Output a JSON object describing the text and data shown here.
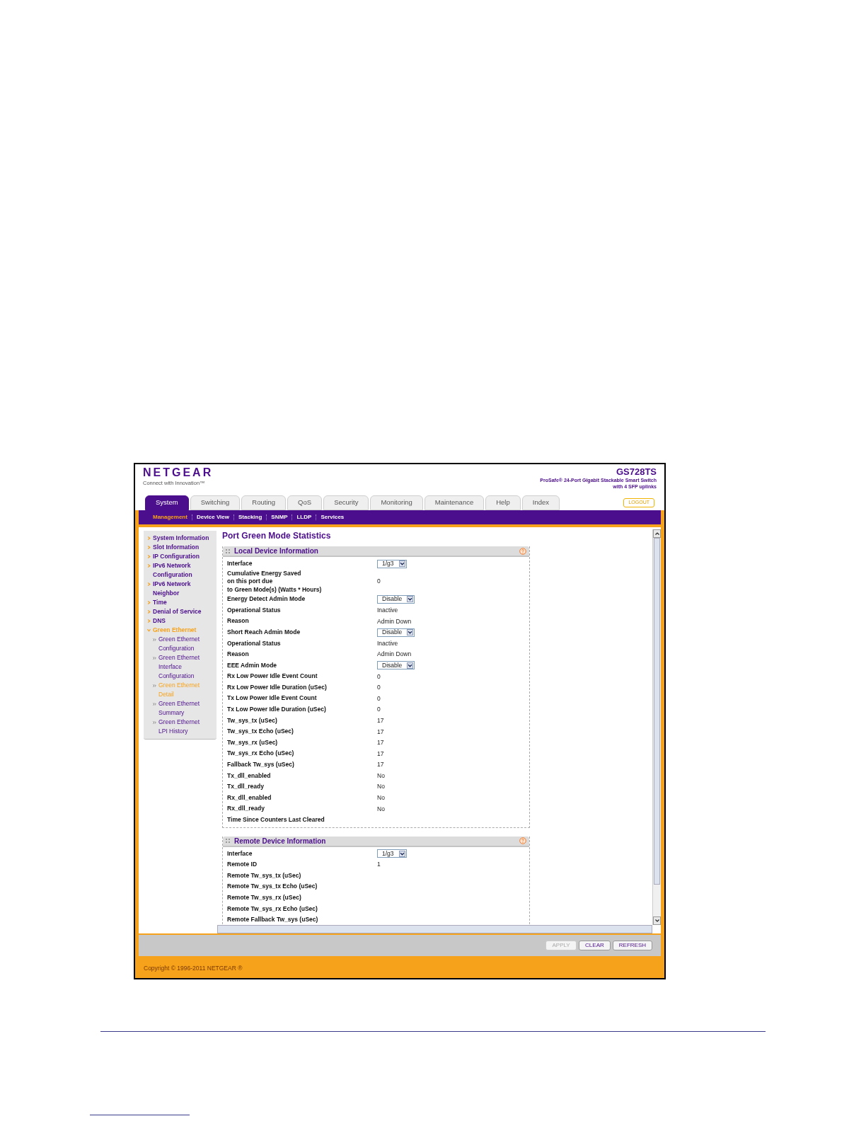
{
  "header": {
    "logo": "NETGEAR",
    "tagline": "Connect with Innovation™",
    "model": "GS728TS",
    "description": [
      "ProSafe® 24-Port Gigabit Stackable Smart Switch",
      "with 4 SFP uplinks"
    ]
  },
  "tabs": [
    {
      "label": "System",
      "selected": true
    },
    {
      "label": "Switching",
      "selected": false
    },
    {
      "label": "Routing",
      "selected": false
    },
    {
      "label": "QoS",
      "selected": false
    },
    {
      "label": "Security",
      "selected": false
    },
    {
      "label": "Monitoring",
      "selected": false
    },
    {
      "label": "Maintenance",
      "selected": false
    },
    {
      "label": "Help",
      "selected": false
    },
    {
      "label": "Index",
      "selected": false
    }
  ],
  "logout": "LOGOUT",
  "subnav": [
    {
      "label": "Management",
      "selected": true
    },
    {
      "label": "Device View",
      "selected": false
    },
    {
      "label": "Stacking",
      "selected": false
    },
    {
      "label": "SNMP",
      "selected": false
    },
    {
      "label": "LLDP",
      "selected": false
    },
    {
      "label": "Services",
      "selected": false
    }
  ],
  "sidebar": {
    "items": [
      {
        "label": "System Information",
        "expanded": false,
        "selected": false
      },
      {
        "label": "Slot Information",
        "expanded": false,
        "selected": false
      },
      {
        "label": "IP Configuration",
        "expanded": false,
        "selected": false
      },
      {
        "label": "IPv6 Network Configuration",
        "expanded": false,
        "selected": false
      },
      {
        "label": "IPv6 Network Neighbor",
        "expanded": false,
        "selected": false
      },
      {
        "label": "Time",
        "expanded": false,
        "selected": false
      },
      {
        "label": "Denial of Service",
        "expanded": false,
        "selected": false
      },
      {
        "label": "DNS",
        "expanded": false,
        "selected": false
      },
      {
        "label": "Green Ethernet",
        "expanded": true,
        "selected": true,
        "children": [
          {
            "label": "Green Ethernet Configuration",
            "selected": false
          },
          {
            "label": "Green Ethernet Interface Configuration",
            "selected": false
          },
          {
            "label": "Green Ethernet Detail",
            "selected": true
          },
          {
            "label": "Green Ethernet Summary",
            "selected": false
          },
          {
            "label": "Green Ethernet LPI History",
            "selected": false
          }
        ]
      }
    ]
  },
  "page_title": "Port Green Mode Statistics",
  "sections": [
    {
      "title": "Local Device Information",
      "rows": [
        {
          "label": "Interface",
          "kind": "select",
          "value": "1/g3"
        },
        {
          "label": "Cumulative Energy Saved\non this port due\nto Green Mode(s) (Watts * Hours)",
          "kind": "text",
          "value": "0"
        },
        {
          "label": "Energy Detect Admin Mode",
          "kind": "select",
          "value": "Disable"
        },
        {
          "label": "Operational Status",
          "kind": "text",
          "value": "Inactive"
        },
        {
          "label": "Reason",
          "kind": "text",
          "value": "Admin Down"
        },
        {
          "label": "Short Reach Admin Mode",
          "kind": "select",
          "value": "Disable"
        },
        {
          "label": "Operational Status",
          "kind": "text",
          "value": "Inactive"
        },
        {
          "label": "Reason",
          "kind": "text",
          "value": "Admin Down"
        },
        {
          "label": "EEE Admin Mode",
          "kind": "select",
          "value": "Disable"
        },
        {
          "label": "Rx Low Power Idle Event Count",
          "kind": "text",
          "value": "0"
        },
        {
          "label": "Rx Low Power Idle Duration (uSec)",
          "kind": "text",
          "value": "0"
        },
        {
          "label": "Tx Low Power Idle Event Count",
          "kind": "text",
          "value": "0"
        },
        {
          "label": "Tx Low Power Idle Duration (uSec)",
          "kind": "text",
          "value": "0"
        },
        {
          "label": "Tw_sys_tx (uSec)",
          "kind": "text",
          "value": "17"
        },
        {
          "label": "Tw_sys_tx Echo (uSec)",
          "kind": "text",
          "value": "17"
        },
        {
          "label": "Tw_sys_rx (uSec)",
          "kind": "text",
          "value": "17"
        },
        {
          "label": "Tw_sys_rx Echo (uSec)",
          "kind": "text",
          "value": "17"
        },
        {
          "label": "Fallback Tw_sys (uSec)",
          "kind": "text",
          "value": "17"
        },
        {
          "label": "Tx_dll_enabled",
          "kind": "text",
          "value": "No"
        },
        {
          "label": "Tx_dll_ready",
          "kind": "text",
          "value": "No"
        },
        {
          "label": "Rx_dll_enabled",
          "kind": "text",
          "value": "No"
        },
        {
          "label": "Rx_dll_ready",
          "kind": "text",
          "value": "No"
        },
        {
          "label": "Time Since Counters Last Cleared",
          "kind": "text"
        }
      ]
    },
    {
      "title": "Remote Device Information",
      "rows": [
        {
          "label": "Interface",
          "kind": "select",
          "value": "1/g3"
        },
        {
          "label": "Remote ID",
          "kind": "text",
          "value": "1"
        },
        {
          "label": "Remote Tw_sys_tx (uSec)",
          "kind": "text"
        },
        {
          "label": "Remote Tw_sys_tx Echo (uSec)",
          "kind": "text"
        },
        {
          "label": "Remote Tw_sys_rx (uSec)",
          "kind": "text"
        },
        {
          "label": "Remote Tw_sys_rx Echo (uSec)",
          "kind": "text"
        },
        {
          "label": "Remote Fallback Tw_sys (uSec)",
          "kind": "text"
        }
      ]
    }
  ],
  "buttons": [
    {
      "label": "APPLY",
      "disabled": true
    },
    {
      "label": "CLEAR",
      "disabled": false
    },
    {
      "label": "REFRESH",
      "disabled": false
    }
  ],
  "copyright": "Copyright © 1996-2011 NETGEAR ®"
}
